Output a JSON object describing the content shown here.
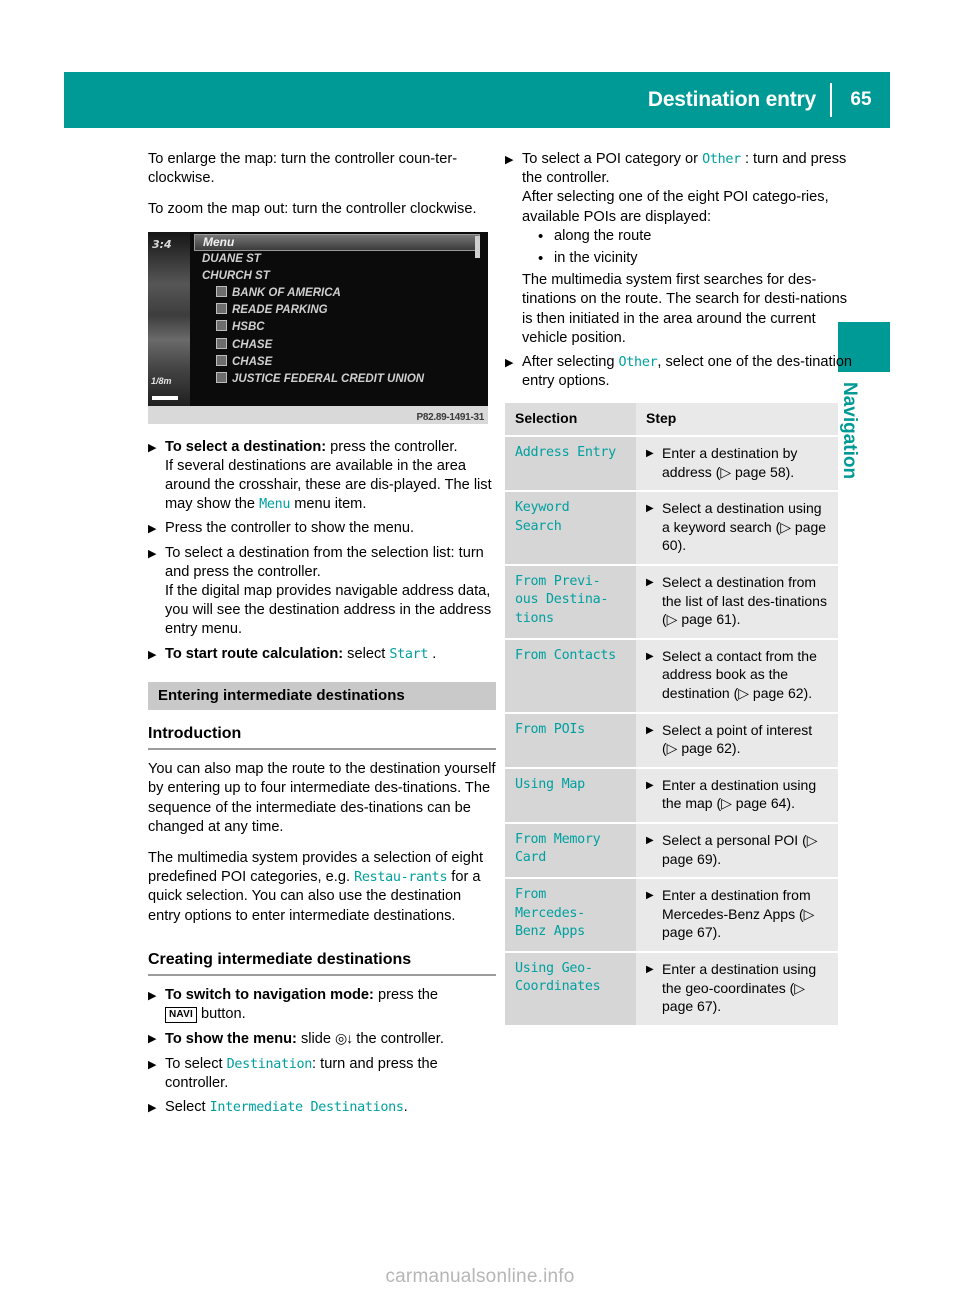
{
  "header": {
    "title": "Destination entry",
    "page_number": "65"
  },
  "side_tab": {
    "label": "Navigation"
  },
  "left_column": {
    "intro": [
      "To enlarge the map: turn the controller coun-ter-clockwise.",
      "To zoom the map out: turn the controller clockwise."
    ],
    "figure": {
      "time": "3:4",
      "scale": "1/8m",
      "menu_label": "Menu",
      "rows": [
        {
          "text": "DUANE ST",
          "icon": false
        },
        {
          "text": "CHURCH ST",
          "icon": false
        },
        {
          "text": "BANK OF AMERICA",
          "icon": true
        },
        {
          "text": "READE PARKING",
          "icon": true
        },
        {
          "text": "HSBC",
          "icon": true
        },
        {
          "text": "CHASE",
          "icon": true
        },
        {
          "text": "CHASE",
          "icon": true
        },
        {
          "text": "JUSTICE FEDERAL CREDIT UNION",
          "icon": true
        }
      ],
      "image_id": "P82.89-1491-31"
    },
    "steps": [
      {
        "bold": "To select a destination:",
        "rest": " press the controller.",
        "cont_a": "If several destinations are available in the area around the crosshair, these are dis-played. The list may show the ",
        "mono": "Menu",
        "cont_b": " menu item."
      },
      {
        "bold": "",
        "rest": "Press the controller to show the menu."
      },
      {
        "bold": "",
        "rest": "To select a destination from the selection list: turn and press the controller.",
        "cont_a": "If the digital map provides navigable address data, you will see the destination address in the address entry menu."
      },
      {
        "bold": "To start route calculation:",
        "rest": " select ",
        "mono": "Start",
        "cont_b": " ."
      }
    ],
    "section_bar": "Entering intermediate destinations",
    "intro_heading": "Introduction",
    "intro_paras": {
      "p1": "You can also map the route to the destination yourself by entering up to four intermediate des-tinations. The sequence of the intermediate des-tinations can be changed at any time.",
      "p2_a": "The multimedia system provides a selection of eight predefined POI categories, e.g. ",
      "p2_mono": "Restau-rants",
      "p2_b": " for a quick selection. You can also use the destination entry options to enter intermediate destinations."
    },
    "creating_heading": "Creating intermediate destinations",
    "creating_steps": {
      "s1_bold": "To switch to navigation mode:",
      "s1_rest": " press the",
      "s1_key": "NAVI",
      "s1_tail": " button.",
      "s2_bold": "To show the menu:",
      "s2_rest": " slide ",
      "s2_glyph": "◎↓",
      "s2_tail": " the controller.",
      "s3_pre": "To select ",
      "s3_mono": "Destination",
      "s3_post": ": turn and press the controller.",
      "s4_pre": "Select ",
      "s4_mono": "Intermediate Destinations",
      "s4_post": "."
    }
  },
  "right_column": {
    "step1": {
      "pre": "To select a POI category or ",
      "mono": "Other",
      "post": " : turn and press the controller.",
      "cont": "After selecting one of the eight POI catego-ries, available POIs are displayed:",
      "bullets": [
        "along the route",
        "in the vicinity"
      ],
      "tail": "The multimedia system first searches for des-tinations on the route. The search for desti-nations is then initiated in the area around the current vehicle position."
    },
    "step2": {
      "pre": "After selecting ",
      "mono": "Other",
      "post": ", select one of the des-tination entry options."
    },
    "table": {
      "headers": [
        "Selection",
        "Step"
      ],
      "rows": [
        {
          "selection": "Address Entry",
          "step": "Enter a destination by address (▷ page 58)."
        },
        {
          "selection": "Keyword\nSearch",
          "step": "Select a destination using a keyword search (▷ page 60)."
        },
        {
          "selection": "From Previ-\nous Destina-\ntions",
          "step": "Select a destination from the list of last des-tinations (▷ page 61)."
        },
        {
          "selection": "From Contacts",
          "step": "Select a contact from the address book as the destination (▷ page 62)."
        },
        {
          "selection": "From POIs",
          "step": "Select a point of interest (▷ page 62)."
        },
        {
          "selection": "Using Map",
          "step": "Enter a destination using the map (▷ page 64)."
        },
        {
          "selection": "From Memory\nCard",
          "step": "Select a personal POI (▷ page 69)."
        },
        {
          "selection": "From\nMercedes-\nBenz Apps",
          "step": "Enter a destination from Mercedes-Benz Apps (▷ page 67)."
        },
        {
          "selection": "Using Geo-\nCoordinates",
          "step": "Enter a destination using the geo-coordinates (▷ page 67)."
        }
      ]
    }
  },
  "footer": {
    "watermark": "carmanualsonline.info"
  },
  "colors": {
    "accent": "#009a96",
    "mono_text": "#00a0a0",
    "section_bar": "#c9c9c9",
    "table_selection_bg": "#d6d6d6",
    "table_step_bg": "#e9e9e9"
  }
}
